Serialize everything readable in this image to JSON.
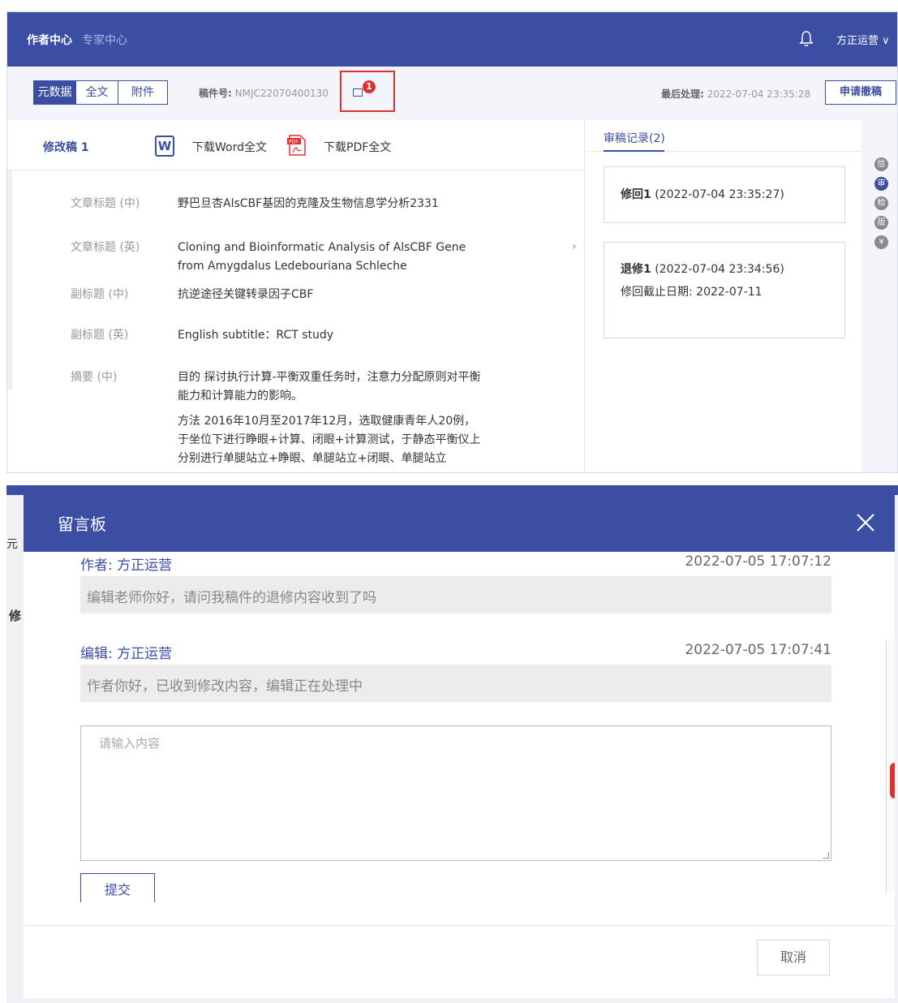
{
  "header": {
    "brand": "作者中心",
    "expert_center": "专家中心",
    "user": "方正运营 ∨"
  },
  "toolbar": {
    "tabs": [
      "元数据",
      "全文",
      "附件"
    ],
    "manuscript_label": "稿件号:",
    "manuscript_no": "NMJC22070400130",
    "message_badge": "1",
    "last_processed_label": "最后处理:",
    "last_processed_time": "2022-07-04 23:35:28",
    "withdraw_button": "申请撤稿"
  },
  "left_pane": {
    "revision_title": "修改稿 1",
    "download_word": "下载Word全文",
    "download_pdf": "下载PDF全文",
    "word_icon_letter": "W",
    "fields": [
      {
        "label": "文章标题 (中)",
        "value": "野巴旦杏AlsCBF基因的克隆及生物信息学分析2331"
      },
      {
        "label": "文章标题 (英)",
        "value": "Cloning and Bioinformatic Analysis of AlsCBF Gene from Amygdalus Ledebouriana Schleche"
      },
      {
        "label": "副标题 (中)",
        "value": "抗逆途径关键转录因子CBF"
      },
      {
        "label": "副标题 (英)",
        "value": "English subtitle：RCT study"
      },
      {
        "label": "摘要 (中)",
        "value": "目的 探讨执行计算-平衡双重任务时，注意力分配原则对平衡能力和计算能力的影响。"
      },
      {
        "label": "",
        "value": "方法 2016年10月至2017年12月，选取健康青年人20例，于坐位下进行睁眼+计算、闭眼+计算测试，于静态平衡仪上分别进行单腿站立+睁眼、单腿站立+闭眼、单腿站立"
      }
    ]
  },
  "right_pane": {
    "tab": "审稿记录(2)",
    "records": [
      {
        "title": "修回1",
        "time": "(2022-07-04 23:35:27)"
      },
      {
        "title": "退修1",
        "time": "(2022-07-04 23:34:56)",
        "deadline_label": "修回截止日期:",
        "deadline": "2022-07-11"
      }
    ],
    "side_buttons": [
      "信",
      "审",
      "检",
      "版",
      "¥"
    ]
  },
  "modal": {
    "title": "留言板",
    "background_left_1": "元",
    "background_left_2": "修",
    "messages": [
      {
        "from": "作者: 方正运营",
        "time": "2022-07-05 17:07:12",
        "text": "编辑老师你好，请问我稿件的退修内容收到了吗"
      },
      {
        "from": "编辑: 方正运营",
        "time": "2022-07-05 17:07:41",
        "text": "作者你好，已收到修改内容，编辑正在处理中"
      }
    ],
    "input_placeholder": "请输入内容",
    "submit": "提交",
    "cancel": "取消"
  },
  "colors": {
    "primary": "#3b4ea3",
    "alert": "#e03131",
    "muted_bg": "#ececec"
  }
}
